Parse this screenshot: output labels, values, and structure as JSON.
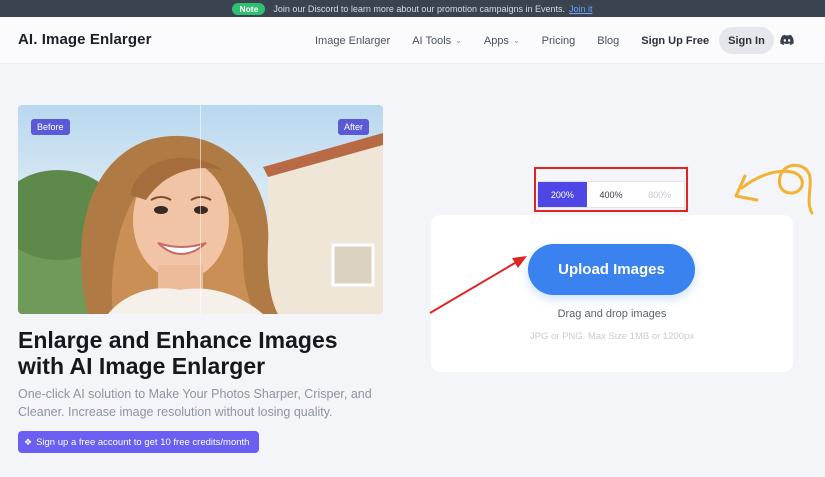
{
  "notice": {
    "badge": "Note",
    "text": "Join our Discord to learn more about our promotion campaigns in Events.",
    "link": "Join it"
  },
  "header": {
    "logo": "AI. Image Enlarger",
    "nav": [
      {
        "label": "Image Enlarger",
        "dropdown": false
      },
      {
        "label": "AI Tools",
        "dropdown": true
      },
      {
        "label": "Apps",
        "dropdown": true
      },
      {
        "label": "Pricing",
        "dropdown": false
      },
      {
        "label": "Blog",
        "dropdown": false
      }
    ],
    "signup_label": "Sign Up Free",
    "signin_label": "Sign In",
    "discord_icon": "discord-icon"
  },
  "hero": {
    "before_label": "Before",
    "after_label": "After",
    "title_line1": "Enlarge and Enhance Images",
    "title_line2": "with AI Image Enlarger",
    "subtitle_line1": "One-click AI solution to Make Your Photos Sharper, Crisper, and",
    "subtitle_line2": "Cleaner. Increase image resolution without losing quality.",
    "cta_label": "Sign up a free account to get 10 free credits/month"
  },
  "scale": {
    "options": [
      "200%",
      "400%",
      "800%"
    ],
    "selected": "200%"
  },
  "upload": {
    "button_label": "Upload Images",
    "drag_text": "Drag and drop images",
    "limits_text": "JPG or PNG. Max Size 1MB or 1200px"
  },
  "colors": {
    "accent": "#4f47e5",
    "upload_button": "#3a82f0",
    "annotation_red": "#e02424",
    "annotation_yellow": "#f2b233",
    "cta": "#6a5ff0"
  }
}
